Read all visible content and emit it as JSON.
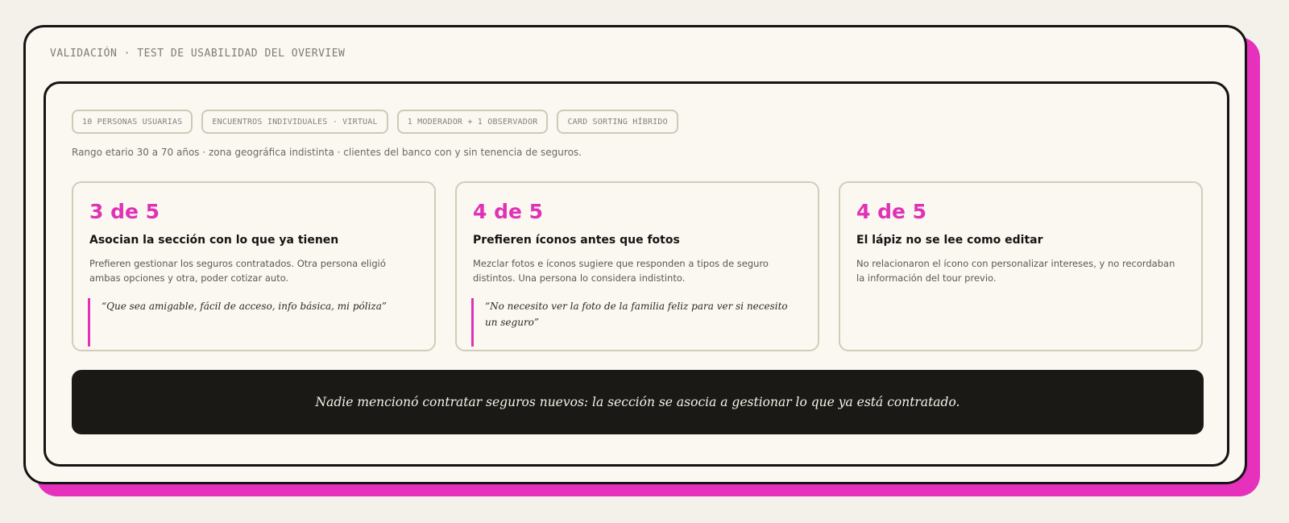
{
  "header": {
    "eyebrow": "VALIDACIÓN · TEST DE USABILIDAD DEL OVERVIEW"
  },
  "tags": [
    "10 PERSONAS USUARIAS",
    "ENCUENTROS INDIVIDUALES · VIRTUAL",
    "1 MODERADOR + 1 OBSERVADOR",
    "CARD SORTING HÍBRIDO"
  ],
  "subtitle": "Rango etario 30 a 70 años · zona geográfica indistinta · clientes del banco con y sin tenencia de seguros.",
  "cards": [
    {
      "stat": "3 de 5",
      "title": "Asocian la sección con lo que ya tienen",
      "body": "Prefieren gestionar los seguros contratados. Otra persona eligió ambas opciones y otra, poder cotizar auto.",
      "quote": "“Que sea amigable, fácil de acceso, info básica, mi póliza”"
    },
    {
      "stat": "4 de 5",
      "title": "Prefieren íconos antes que fotos",
      "body": "Mezclar fotos e íconos sugiere que responden a tipos de seguro distintos. Una persona lo considera indistinto.",
      "quote": "“No necesito ver la foto de la familia feliz para ver si necesito un seguro”"
    },
    {
      "stat": "4 de 5",
      "title": "El lápiz no se lee como editar",
      "body": "No relacionaron el ícono con personalizar intereses, y no recordaban la información del tour previo.",
      "quote": ""
    }
  ],
  "banner": {
    "text": "Nadie mencionó contratar seguros nuevos: la sección se asocia a gestionar lo que ya está contratado."
  },
  "colors": {
    "accent": "#e032b6",
    "background": "#faf8f1",
    "ink": "#141414"
  }
}
